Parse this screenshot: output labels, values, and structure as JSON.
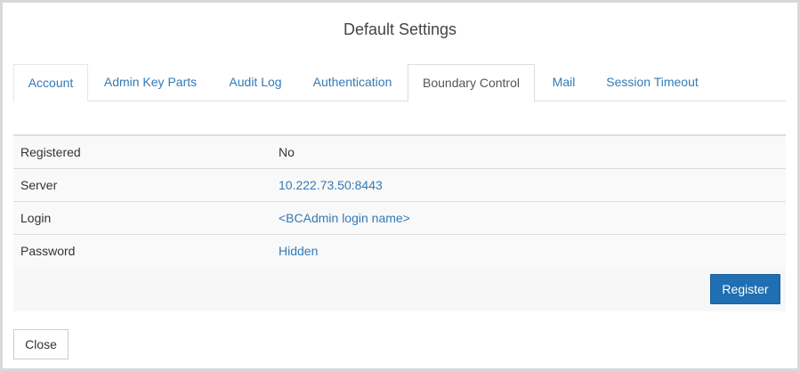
{
  "dialog": {
    "title": "Default Settings"
  },
  "tabs": [
    {
      "label": "Account"
    },
    {
      "label": "Admin Key Parts"
    },
    {
      "label": "Audit Log"
    },
    {
      "label": "Authentication"
    },
    {
      "label": "Boundary Control"
    },
    {
      "label": "Mail"
    },
    {
      "label": "Session Timeout"
    }
  ],
  "active_tab": "Boundary Control",
  "settings": [
    {
      "label": "Registered",
      "value": "No"
    },
    {
      "label": "Server",
      "value": "10.222.73.50:8443"
    },
    {
      "label": "Login",
      "value": "<BCAdmin login name>"
    },
    {
      "label": "Password",
      "value": "Hidden"
    }
  ],
  "buttons": {
    "register": "Register",
    "close": "Close"
  },
  "colors": {
    "link": "#337ab7",
    "primary_button": "#1f6fb2",
    "row_background": "#f9f9f9"
  }
}
